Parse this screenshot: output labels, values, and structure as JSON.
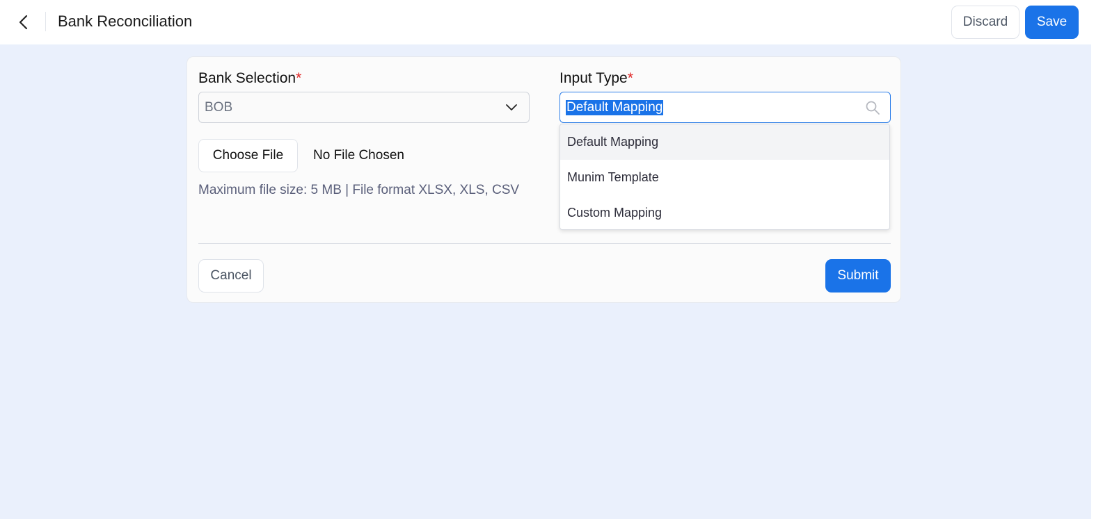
{
  "header": {
    "title": "Bank Reconciliation",
    "discard_label": "Discard",
    "save_label": "Save"
  },
  "form": {
    "bank_selection": {
      "label": "Bank Selection",
      "required_mark": "*",
      "value": "BOB"
    },
    "input_type": {
      "label": "Input Type",
      "required_mark": "*",
      "value": "Default Mapping",
      "options": [
        "Default Mapping",
        "Munim Template",
        "Custom Mapping"
      ],
      "highlighted_index": 0
    },
    "file": {
      "choose_label": "Choose File",
      "status": "No File Chosen",
      "hint": "Maximum file size: 5 MB | File format XLSX, XLS, CSV"
    },
    "cancel_label": "Cancel",
    "submit_label": "Submit"
  },
  "icons": {
    "back": "chevron-left-icon",
    "dropdown": "chevron-down-icon",
    "search": "search-icon"
  },
  "colors": {
    "primary": "#1a73e8",
    "required": "#e02424",
    "page_background": "#eaf0fc"
  }
}
